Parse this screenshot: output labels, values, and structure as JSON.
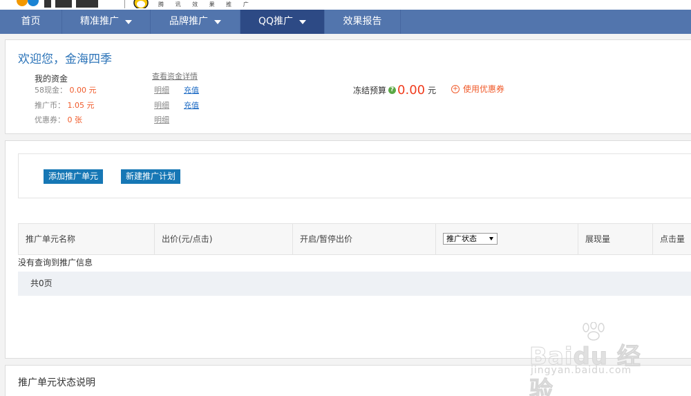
{
  "header": {
    "tagline": "腾 讯 效 果 推 广"
  },
  "nav": {
    "items": [
      {
        "label": "首页",
        "dropdown": false
      },
      {
        "label": "精准推广",
        "dropdown": true
      },
      {
        "label": "品牌推广",
        "dropdown": true
      },
      {
        "label": "QQ推广",
        "dropdown": true,
        "active": true
      },
      {
        "label": "效果报告",
        "dropdown": false
      }
    ]
  },
  "welcome": {
    "greeting": "欢迎您，金海四季",
    "funds_title": "我的资金",
    "funds_detail_link": "查看资金详情",
    "rows": [
      {
        "label": "58现金：",
        "value": "0.00 元",
        "detail": "明细",
        "recharge": "充值"
      },
      {
        "label": "推广币：",
        "value": "1.05 元",
        "detail": "明细",
        "recharge": "充值"
      },
      {
        "label": "优惠券：",
        "value": "0 张",
        "detail": "明细"
      }
    ],
    "frozen_label": "冻结预算",
    "frozen_amount": "0.00",
    "frozen_unit": "元",
    "coupon_link": "使用优惠券"
  },
  "toolbar": {
    "add_unit": "添加推广单元",
    "new_plan": "新建推广计划"
  },
  "table": {
    "columns": [
      "推广单元名称",
      "出价(元/点击)",
      "开启/暂停出价",
      "推广状态",
      "展现量",
      "点击量"
    ],
    "status_select_value": "推广状态",
    "empty_message": "没有查询到推广信息",
    "pager": "共0页"
  },
  "legend": {
    "title": "推广单元状态说明"
  },
  "watermark": {
    "url": "jingyan.baidu.com"
  },
  "colors": {
    "nav_bg": "#5275ad",
    "nav_active": "#2d4a85",
    "accent_blue": "#2b73b8",
    "button_blue": "#1677b5",
    "amount_red": "#f03c1e"
  }
}
